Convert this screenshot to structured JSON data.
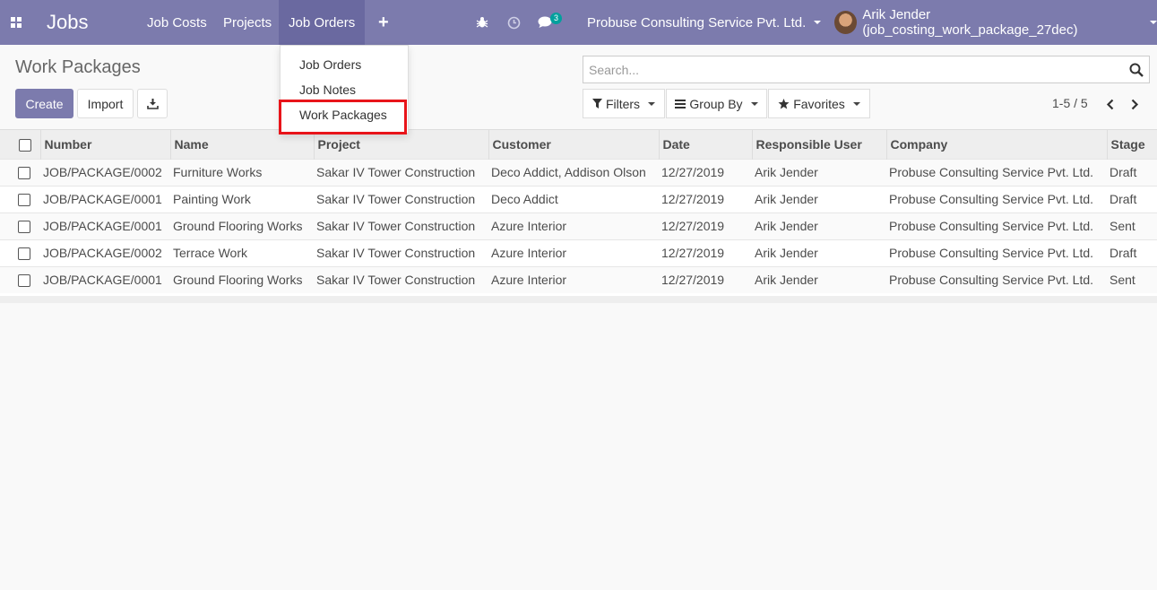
{
  "navbar": {
    "brand": "Jobs",
    "menu_items": [
      "Job Costs",
      "Projects",
      "Job Orders"
    ],
    "active_item": "Job Orders",
    "messages_count": "3",
    "company": "Probuse Consulting Service Pvt. Ltd.",
    "user": "Arik Jender (job_costing_work_package_27dec)",
    "icons": [
      "apps-icon",
      "plus-icon",
      "bug-icon",
      "clock-icon",
      "chat-icon",
      "avatar"
    ]
  },
  "dropdown": {
    "items": [
      "Job Orders",
      "Job Notes",
      "Work Packages"
    ],
    "highlighted": "Work Packages"
  },
  "control_panel": {
    "title": "Work Packages",
    "create_label": "Create",
    "import_label": "Import",
    "search_placeholder": "Search...",
    "filters_label": "Filters",
    "groupby_label": "Group By",
    "favorites_label": "Favorites",
    "pager": "1-5 / 5"
  },
  "table": {
    "columns": [
      "Number",
      "Name",
      "Project",
      "Customer",
      "Date",
      "Responsible User",
      "Company",
      "Stage"
    ],
    "rows": [
      [
        "JOB/PACKAGE/0002",
        "Furniture Works",
        "Sakar IV Tower Construction",
        "Deco Addict, Addison Olson",
        "12/27/2019",
        "Arik Jender",
        "Probuse Consulting Service Pvt. Ltd.",
        "Draft"
      ],
      [
        "JOB/PACKAGE/0001",
        "Painting Work",
        "Sakar IV Tower Construction",
        "Deco Addict",
        "12/27/2019",
        "Arik Jender",
        "Probuse Consulting Service Pvt. Ltd.",
        "Draft"
      ],
      [
        "JOB/PACKAGE/0001",
        "Ground Flooring Works",
        "Sakar IV Tower Construction",
        "Azure Interior",
        "12/27/2019",
        "Arik Jender",
        "Probuse Consulting Service Pvt. Ltd.",
        "Sent"
      ],
      [
        "JOB/PACKAGE/0002",
        "Terrace Work",
        "Sakar IV Tower Construction",
        "Azure Interior",
        "12/27/2019",
        "Arik Jender",
        "Probuse Consulting Service Pvt. Ltd.",
        "Draft"
      ],
      [
        "JOB/PACKAGE/0001",
        "Ground Flooring Works",
        "Sakar IV Tower Construction",
        "Azure Interior",
        "12/27/2019",
        "Arik Jender",
        "Probuse Consulting Service Pvt. Ltd.",
        "Sent"
      ]
    ]
  },
  "colors": {
    "navbar": "#7c7bad",
    "active_nav": "#6a69a0",
    "primary_button": "#7c7bad",
    "badge": "#00a09d",
    "highlight_box": "#e8141a"
  }
}
